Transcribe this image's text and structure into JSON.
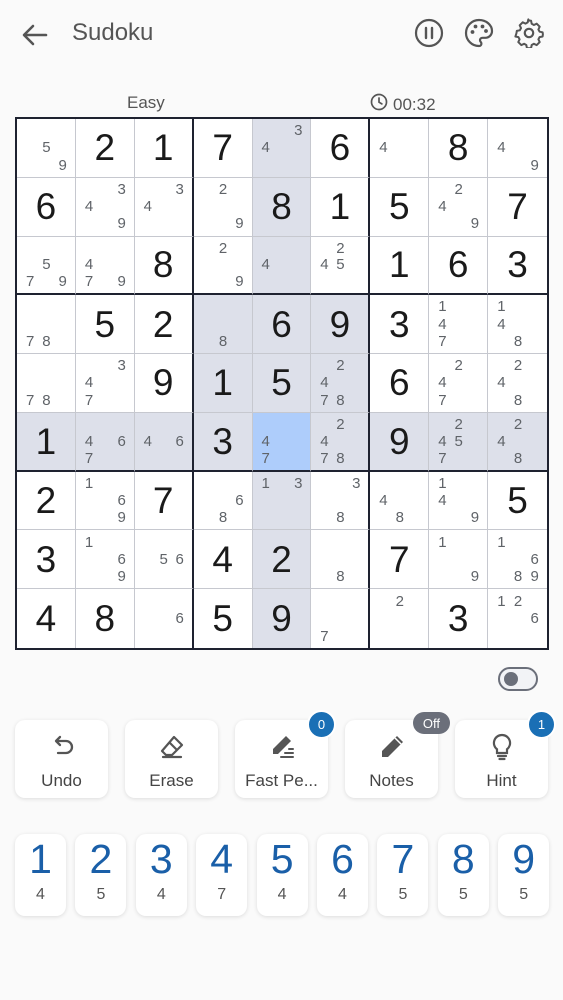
{
  "header": {
    "title": "Sudoku"
  },
  "info": {
    "difficulty": "Easy",
    "timer": "00:32"
  },
  "board": [
    [
      {
        "n": [
          "5",
          "9"
        ]
      },
      {
        "v": "2"
      },
      {
        "v": "1"
      },
      {
        "v": "7"
      },
      {
        "n": [
          "3",
          "4"
        ]
      },
      {
        "v": "6"
      },
      {
        "n": [
          "4"
        ]
      },
      {
        "v": "8"
      },
      {
        "n": [
          "4",
          "9"
        ]
      }
    ],
    [
      {
        "v": "6"
      },
      {
        "n": [
          "3",
          "4",
          "9"
        ]
      },
      {
        "n": [
          "3",
          "4"
        ]
      },
      {
        "n": [
          "2",
          "9"
        ]
      },
      {
        "v": "8"
      },
      {
        "v": "1"
      },
      {
        "v": "5"
      },
      {
        "n": [
          "2",
          "4",
          "9"
        ]
      },
      {
        "v": "7"
      }
    ],
    [
      {
        "n": [
          "5",
          "7",
          "9"
        ]
      },
      {
        "n": [
          "4",
          "7",
          "9"
        ]
      },
      {
        "v": "8"
      },
      {
        "n": [
          "2",
          "9"
        ]
      },
      {
        "n": [
          "4"
        ]
      },
      {
        "n": [
          "2",
          "4",
          "5"
        ]
      },
      {
        "v": "1"
      },
      {
        "v": "6"
      },
      {
        "v": "3"
      }
    ],
    [
      {
        "n": [
          "7",
          "8"
        ]
      },
      {
        "v": "5"
      },
      {
        "v": "2"
      },
      {
        "n": [
          "8"
        ]
      },
      {
        "v": "6"
      },
      {
        "v": "9"
      },
      {
        "v": "3"
      },
      {
        "n": [
          "1",
          "4",
          "7"
        ]
      },
      {
        "n": [
          "1",
          "4",
          "8"
        ]
      }
    ],
    [
      {
        "n": [
          "7",
          "8"
        ]
      },
      {
        "n": [
          "3",
          "4",
          "7"
        ]
      },
      {
        "v": "9"
      },
      {
        "v": "1"
      },
      {
        "v": "5"
      },
      {
        "n": [
          "2",
          "4",
          "7",
          "8"
        ]
      },
      {
        "v": "6"
      },
      {
        "n": [
          "2",
          "4",
          "7"
        ]
      },
      {
        "n": [
          "2",
          "4",
          "8"
        ]
      }
    ],
    [
      {
        "v": "1"
      },
      {
        "n": [
          "4",
          "6",
          "7"
        ]
      },
      {
        "n": [
          "4",
          "6"
        ]
      },
      {
        "v": "3"
      },
      {
        "n": [
          "4",
          "7"
        ]
      },
      {
        "n": [
          "2",
          "4",
          "7",
          "8"
        ]
      },
      {
        "v": "9"
      },
      {
        "n": [
          "2",
          "4",
          "5",
          "7"
        ]
      },
      {
        "n": [
          "2",
          "4",
          "8"
        ]
      }
    ],
    [
      {
        "v": "2"
      },
      {
        "n": [
          "1",
          "6",
          "9"
        ]
      },
      {
        "v": "7"
      },
      {
        "n": [
          "6",
          "8"
        ]
      },
      {
        "n": [
          "1",
          "3"
        ]
      },
      {
        "n": [
          "3",
          "8"
        ]
      },
      {
        "n": [
          "4",
          "8"
        ]
      },
      {
        "n": [
          "1",
          "4",
          "9"
        ]
      },
      {
        "v": "5"
      }
    ],
    [
      {
        "v": "3"
      },
      {
        "n": [
          "1",
          "6",
          "9"
        ]
      },
      {
        "n": [
          "5",
          "6"
        ]
      },
      {
        "v": "4"
      },
      {
        "v": "2"
      },
      {
        "n": [
          "8"
        ]
      },
      {
        "v": "7"
      },
      {
        "n": [
          "1",
          "9"
        ]
      },
      {
        "n": [
          "1",
          "6",
          "8",
          "9"
        ]
      }
    ],
    [
      {
        "v": "4"
      },
      {
        "v": "8"
      },
      {
        "n": [
          "6"
        ]
      },
      {
        "v": "5"
      },
      {
        "v": "9"
      },
      {
        "n": [
          "7"
        ]
      },
      {
        "n": [
          "2"
        ]
      },
      {
        "v": "3"
      },
      {
        "n": [
          "1",
          "2",
          "6"
        ]
      }
    ]
  ],
  "highlight": {
    "selected": [
      5,
      4
    ],
    "cells": [
      [
        0,
        4
      ],
      [
        1,
        4
      ],
      [
        2,
        4
      ],
      [
        3,
        3
      ],
      [
        3,
        4
      ],
      [
        3,
        5
      ],
      [
        4,
        3
      ],
      [
        4,
        4
      ],
      [
        4,
        5
      ],
      [
        5,
        0
      ],
      [
        5,
        1
      ],
      [
        5,
        2
      ],
      [
        5,
        3
      ],
      [
        5,
        5
      ],
      [
        5,
        6
      ],
      [
        5,
        7
      ],
      [
        5,
        8
      ],
      [
        6,
        4
      ],
      [
        7,
        4
      ],
      [
        8,
        4
      ]
    ]
  },
  "actions": [
    {
      "label": "Undo",
      "icon": "undo-icon"
    },
    {
      "label": "Erase",
      "icon": "eraser-icon"
    },
    {
      "label": "Fast Pe...",
      "icon": "fast-pencil-icon",
      "badge": "0"
    },
    {
      "label": "Notes",
      "icon": "pencil-icon",
      "pill": "Off"
    },
    {
      "label": "Hint",
      "icon": "lightbulb-icon",
      "badge": "1"
    }
  ],
  "numpad": [
    {
      "digit": "1",
      "count": "4"
    },
    {
      "digit": "2",
      "count": "5"
    },
    {
      "digit": "3",
      "count": "4"
    },
    {
      "digit": "4",
      "count": "7"
    },
    {
      "digit": "5",
      "count": "4"
    },
    {
      "digit": "6",
      "count": "4"
    },
    {
      "digit": "7",
      "count": "5"
    },
    {
      "digit": "8",
      "count": "5"
    },
    {
      "digit": "9",
      "count": "5"
    }
  ],
  "colors": {
    "accent": "#1a6fb5",
    "selected": "#aecdfb",
    "highlight": "#dde0ea",
    "digit": "#1a5fa8"
  }
}
